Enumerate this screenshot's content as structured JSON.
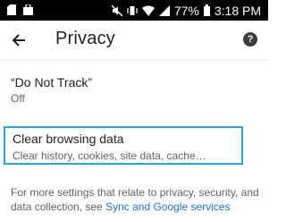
{
  "status_bar": {
    "battery_percent": "77%",
    "time": "3:18 PM"
  },
  "app_bar": {
    "title": "Privacy"
  },
  "settings": {
    "do_not_track": {
      "title": "“Do Not Track”",
      "value": "Off"
    },
    "clear_browsing_data": {
      "title": "Clear browsing data",
      "subtitle": "Clear history, cookies, site data, cache…"
    }
  },
  "footer": {
    "text_before_link": "For more settings that relate to privacy, security, and data collection, see ",
    "link": "Sync and Google services"
  },
  "colors": {
    "highlight_border": "#29a6dc",
    "link": "#1a73e8"
  }
}
